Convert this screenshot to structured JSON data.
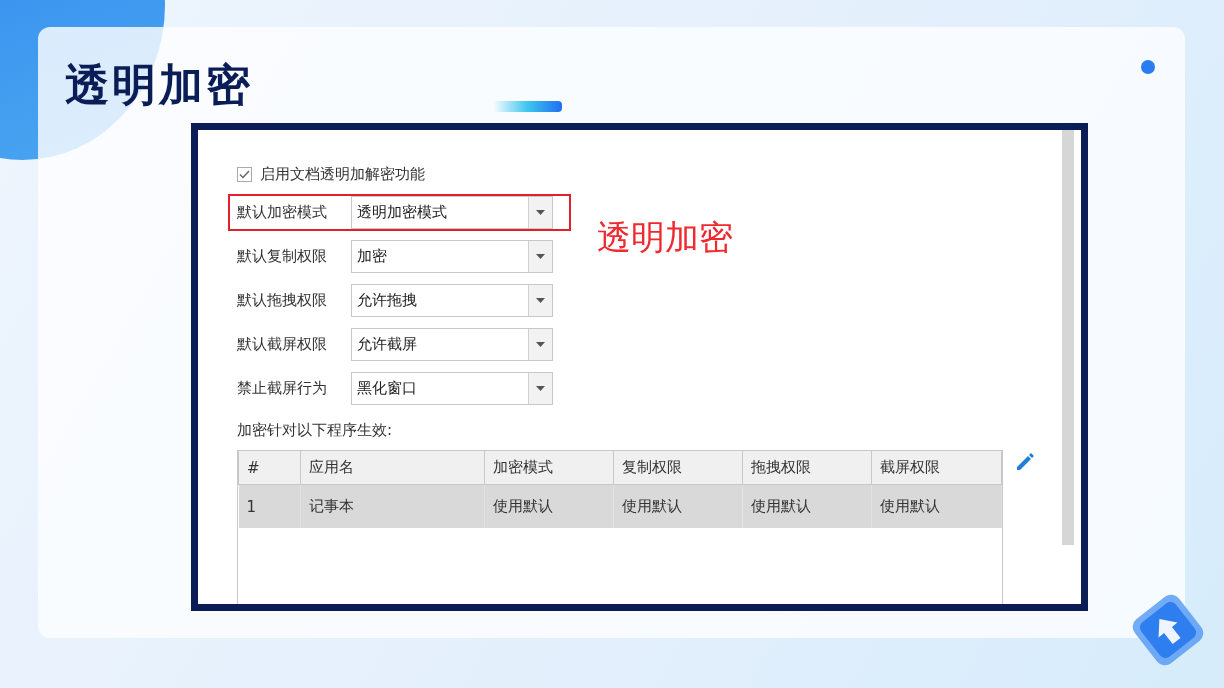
{
  "slide": {
    "title": "透明加密"
  },
  "screenshot": {
    "checkbox": {
      "label": "启用文档透明加解密功能",
      "checked": true
    },
    "fields": [
      {
        "label": "默认加密模式",
        "value": "透明加密模式",
        "highlighted": true
      },
      {
        "label": "默认复制权限",
        "value": "加密",
        "highlighted": false
      },
      {
        "label": "默认拖拽权限",
        "value": "允许拖拽",
        "highlighted": false
      },
      {
        "label": "默认截屏权限",
        "value": "允许截屏",
        "highlighted": false
      },
      {
        "label": "禁止截屏行为",
        "value": "黑化窗口",
        "highlighted": false
      }
    ],
    "programs_label": "加密针对以下程序生效:",
    "table": {
      "columns": [
        "#",
        "应用名",
        "加密模式",
        "复制权限",
        "拖拽权限",
        "截屏权限"
      ],
      "rows": [
        {
          "cells": [
            "1",
            "记事本",
            "使用默认",
            "使用默认",
            "使用默认",
            "使用默认"
          ],
          "selected": true
        }
      ]
    }
  },
  "annotation": "透明加密"
}
